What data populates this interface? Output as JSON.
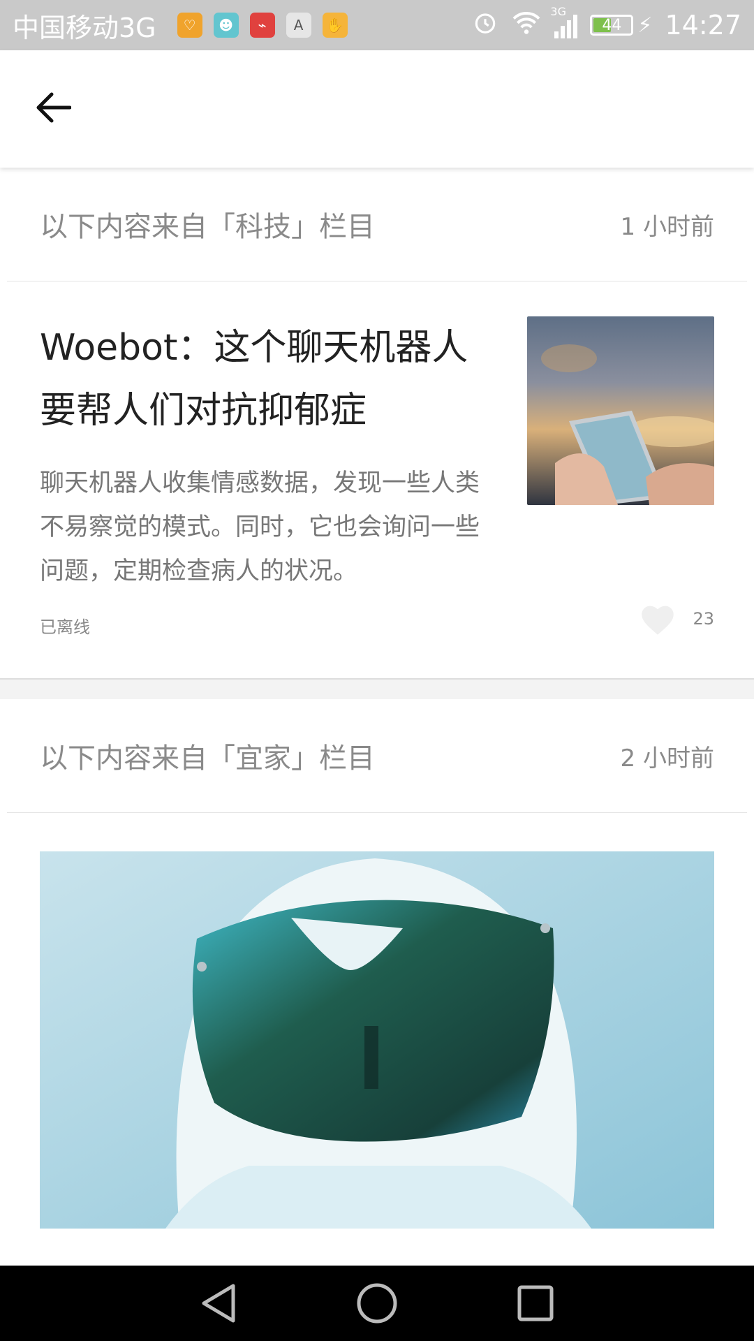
{
  "status_bar": {
    "carrier": "中国移动3G",
    "network_type": "3G",
    "battery_level": "44",
    "time": "14:27",
    "app_icons": [
      "health-app-icon",
      "android-app-icon",
      "stocks-app-icon",
      "font-app-icon",
      "hand-app-icon"
    ]
  },
  "top_bar": {
    "back_icon": "arrow-left-icon"
  },
  "feed": {
    "sections": [
      {
        "title": "以下内容来自「科技」栏目",
        "time": "1 小时前",
        "article": {
          "title": "Woebot：这个聊天机器人要帮人们对抗抑郁症",
          "summary": "聊天机器人收集情感数据，发现一些人类不易察觉的模式。同时，它也会询问一些问题，定期检查病人的状况。",
          "source": "已离线",
          "like_count": "23",
          "thumbnail": "phone-in-hand-photo"
        }
      },
      {
        "title": "以下内容来自「宜家」栏目",
        "time": "2 小时前",
        "hero_image": "astronaut-helmet-photo"
      }
    ]
  },
  "nav_bar": {
    "buttons": [
      "back-triangle-icon",
      "home-circle-icon",
      "recents-square-icon"
    ]
  },
  "colors": {
    "status_bar_bg": "#c9c9c9",
    "text_primary": "#222222",
    "text_secondary": "#8a8a8a",
    "battery_fill": "#7ec04c"
  }
}
